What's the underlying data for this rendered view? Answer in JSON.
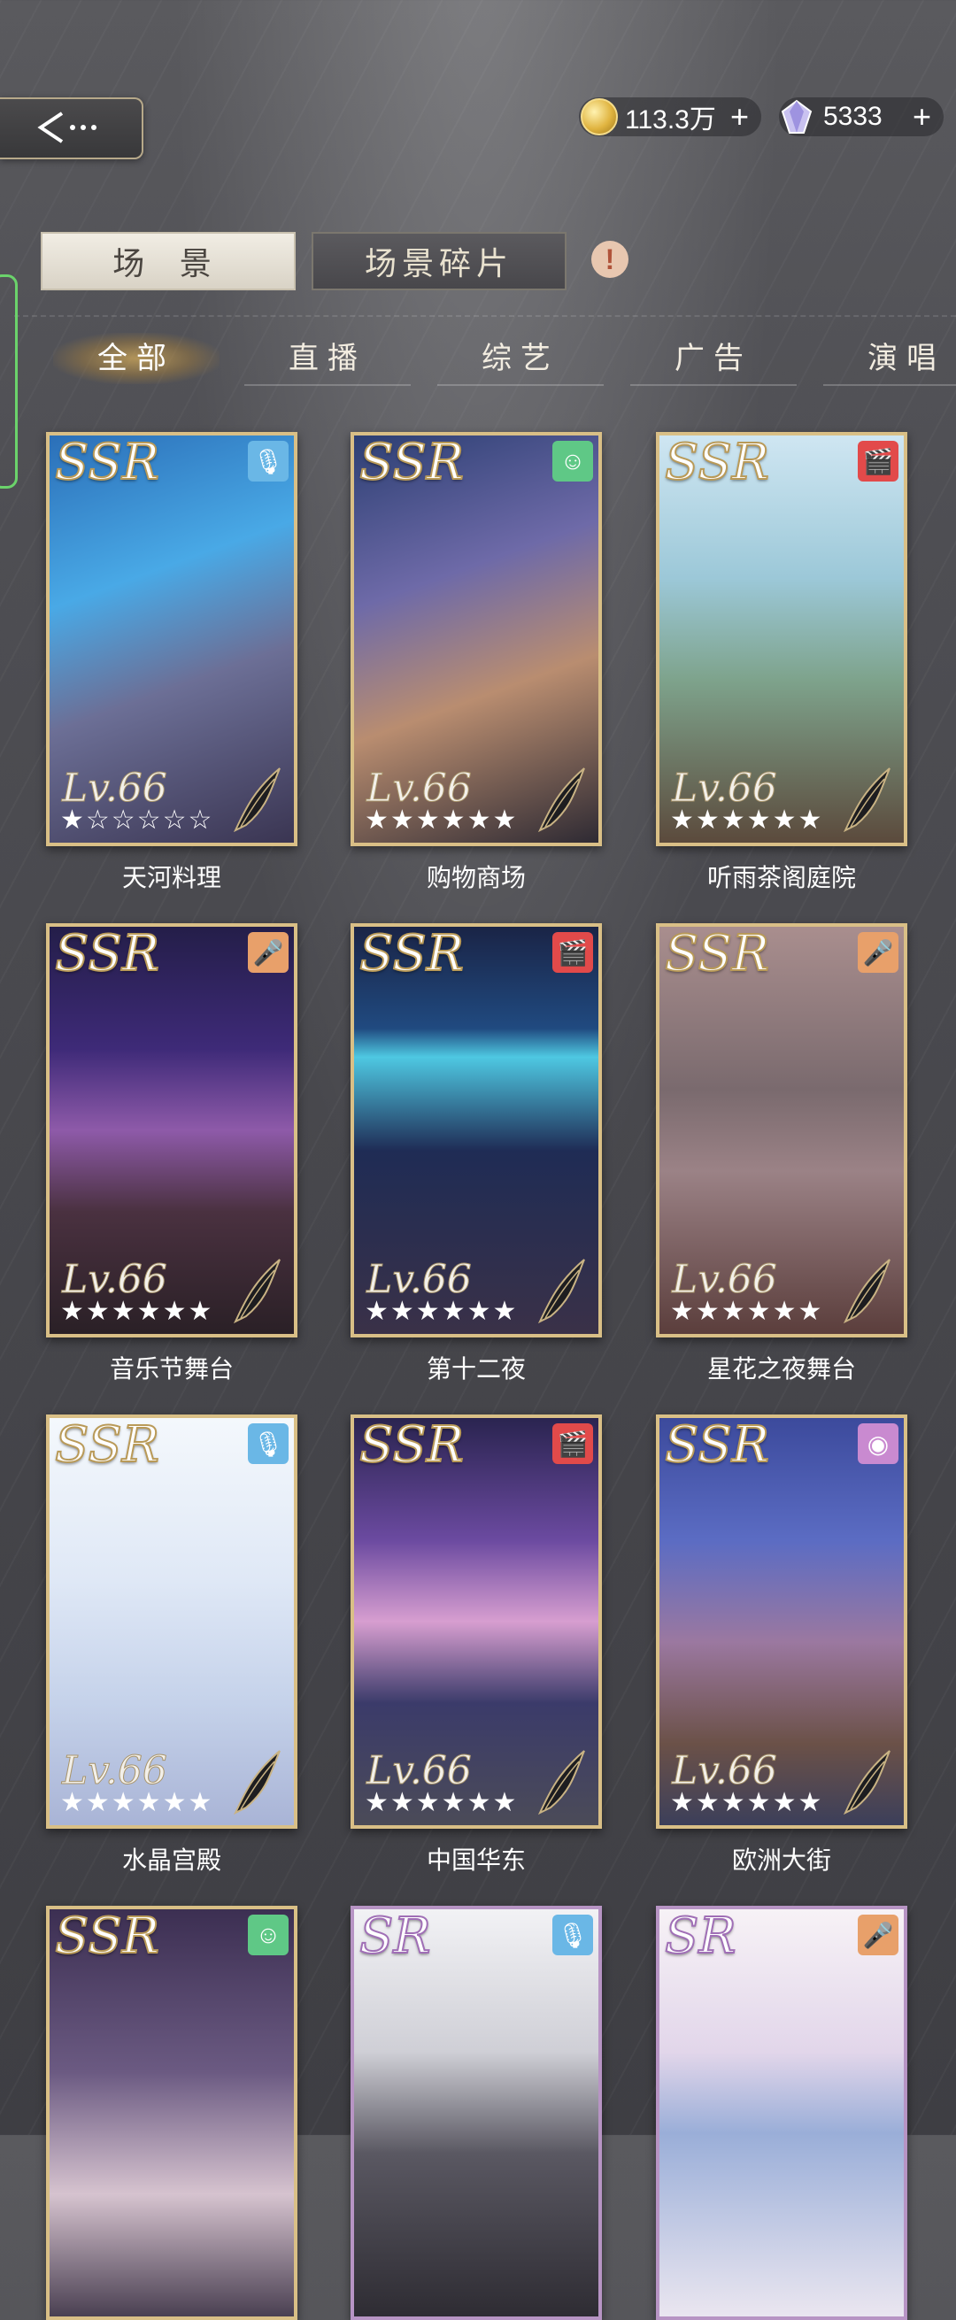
{
  "topbar": {
    "gold_value": "113.3万",
    "gem_value": "5333",
    "plus_label": "+"
  },
  "tabs": {
    "scene": "场 景",
    "fragments": "场景碎片",
    "info": "!"
  },
  "filters": [
    "全部",
    "直播",
    "综艺",
    "广告",
    "演唱"
  ],
  "cards": [
    {
      "name": "天河料理",
      "rarity": "SSR",
      "level": "Lv.66",
      "stars": "★☆☆☆☆☆",
      "icon": "microphone-icon",
      "icon_glyph": "🎙",
      "icon_color": "#6ab7e6"
    },
    {
      "name": "购物商场",
      "rarity": "SSR",
      "level": "Lv.66",
      "stars": "★★★★★★",
      "icon": "smiley-icon",
      "icon_glyph": "☺",
      "icon_color": "#5fc886"
    },
    {
      "name": "听雨茶阁庭院",
      "rarity": "SSR",
      "level": "Lv.66",
      "stars": "★★★★★★",
      "icon": "clapperboard-icon",
      "icon_glyph": "🎬",
      "icon_color": "#e24a4a"
    },
    {
      "name": "音乐节舞台",
      "rarity": "SSR",
      "level": "Lv.66",
      "stars": "★★★★★★",
      "icon": "handheld-mic-icon",
      "icon_glyph": "🎤",
      "icon_color": "#e8a06a"
    },
    {
      "name": "第十二夜",
      "rarity": "SSR",
      "level": "Lv.66",
      "stars": "★★★★★★",
      "icon": "clapperboard-icon",
      "icon_glyph": "🎬",
      "icon_color": "#e24a4a"
    },
    {
      "name": "星花之夜舞台",
      "rarity": "SSR",
      "level": "Lv.66",
      "stars": "★★★★★★",
      "icon": "handheld-mic-icon",
      "icon_glyph": "🎤",
      "icon_color": "#e8a06a"
    },
    {
      "name": "水晶宫殿",
      "rarity": "SSR",
      "level": "Lv.66",
      "stars": "★★★★★★",
      "icon": "microphone-icon",
      "icon_glyph": "🎙",
      "icon_color": "#6ab7e6"
    },
    {
      "name": "中国华东",
      "rarity": "SSR",
      "level": "Lv.66",
      "stars": "★★★★★★",
      "icon": "clapperboard-icon",
      "icon_glyph": "🎬",
      "icon_color": "#e24a4a"
    },
    {
      "name": "欧洲大街",
      "rarity": "SSR",
      "level": "Lv.66",
      "stars": "★★★★★★",
      "icon": "vinyl-icon",
      "icon_glyph": "◉",
      "icon_color": "#c98ad0"
    },
    {
      "name": "",
      "rarity": "SSR",
      "level": "",
      "stars": "",
      "icon": "smiley-icon",
      "icon_glyph": "☺",
      "icon_color": "#5fc886"
    },
    {
      "name": "",
      "rarity": "SR",
      "level": "",
      "stars": "",
      "icon": "microphone-icon",
      "icon_glyph": "🎙",
      "icon_color": "#6ab7e6"
    },
    {
      "name": "",
      "rarity": "SR",
      "level": "",
      "stars": "",
      "icon": "handheld-mic-icon",
      "icon_glyph": "🎤",
      "icon_color": "#e8a06a"
    }
  ]
}
